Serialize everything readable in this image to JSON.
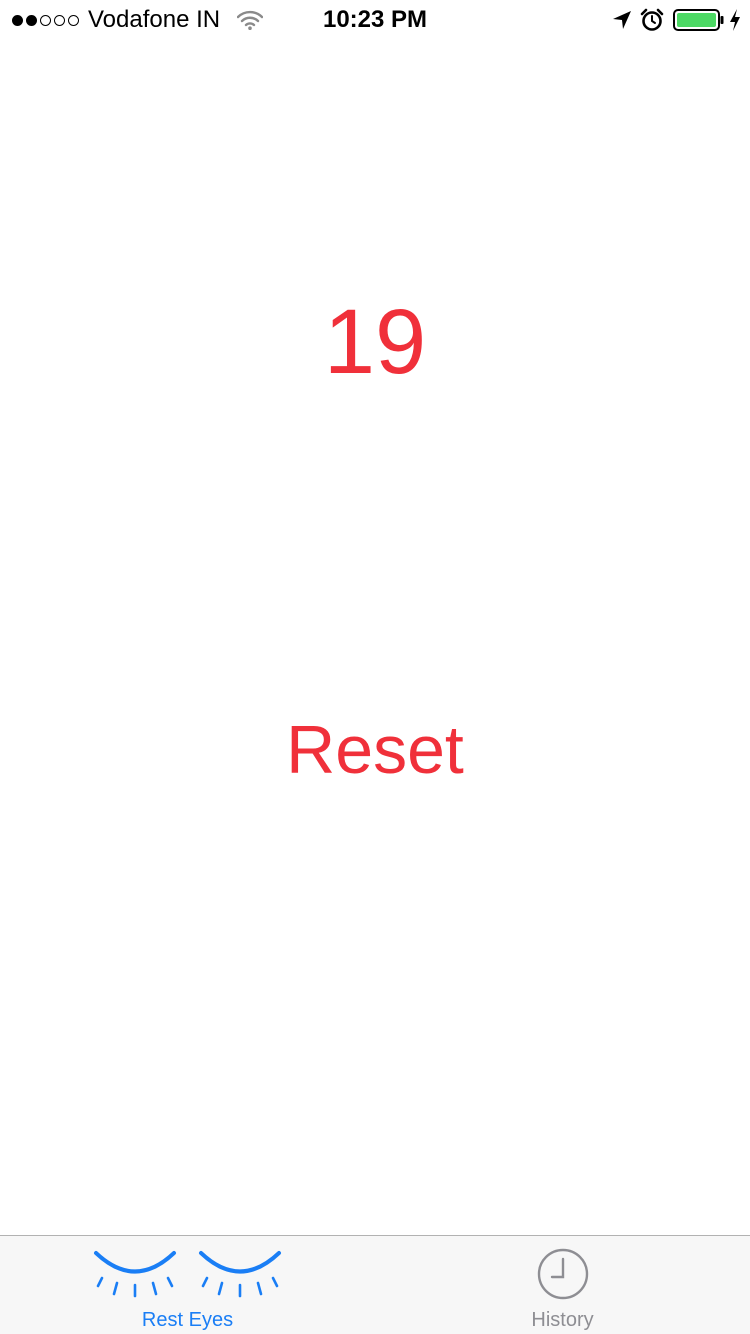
{
  "status_bar": {
    "carrier": "Vodafone IN",
    "time": "10:23 PM",
    "signal_strength": 2,
    "signal_max": 5,
    "battery_level": 1.0,
    "battery_color": "#4cd964"
  },
  "main": {
    "counter": "19",
    "reset_label": "Reset",
    "accent_color": "#f0303a"
  },
  "tab_bar": {
    "tabs": [
      {
        "label": "Rest Eyes",
        "icon": "closed-eyes-icon",
        "selected": true,
        "color": "#1a7ef5"
      },
      {
        "label": "History",
        "icon": "clock-icon",
        "selected": false,
        "color": "#8e8e93"
      }
    ]
  }
}
